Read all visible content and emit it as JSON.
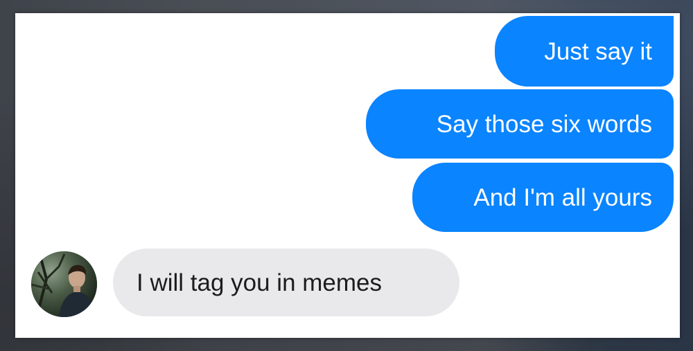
{
  "conversation": {
    "outgoing_messages": [
      {
        "text": "Just say it"
      },
      {
        "text": "Say those six words"
      },
      {
        "text": "And I'm all yours"
      }
    ],
    "incoming_messages": [
      {
        "text": "I will tag you in memes"
      }
    ]
  },
  "colors": {
    "outgoing_bubble": "#0a84ff",
    "incoming_bubble": "#e9e9eb",
    "panel_background": "#ffffff"
  },
  "icons": {
    "avatar": "contact-photo"
  }
}
